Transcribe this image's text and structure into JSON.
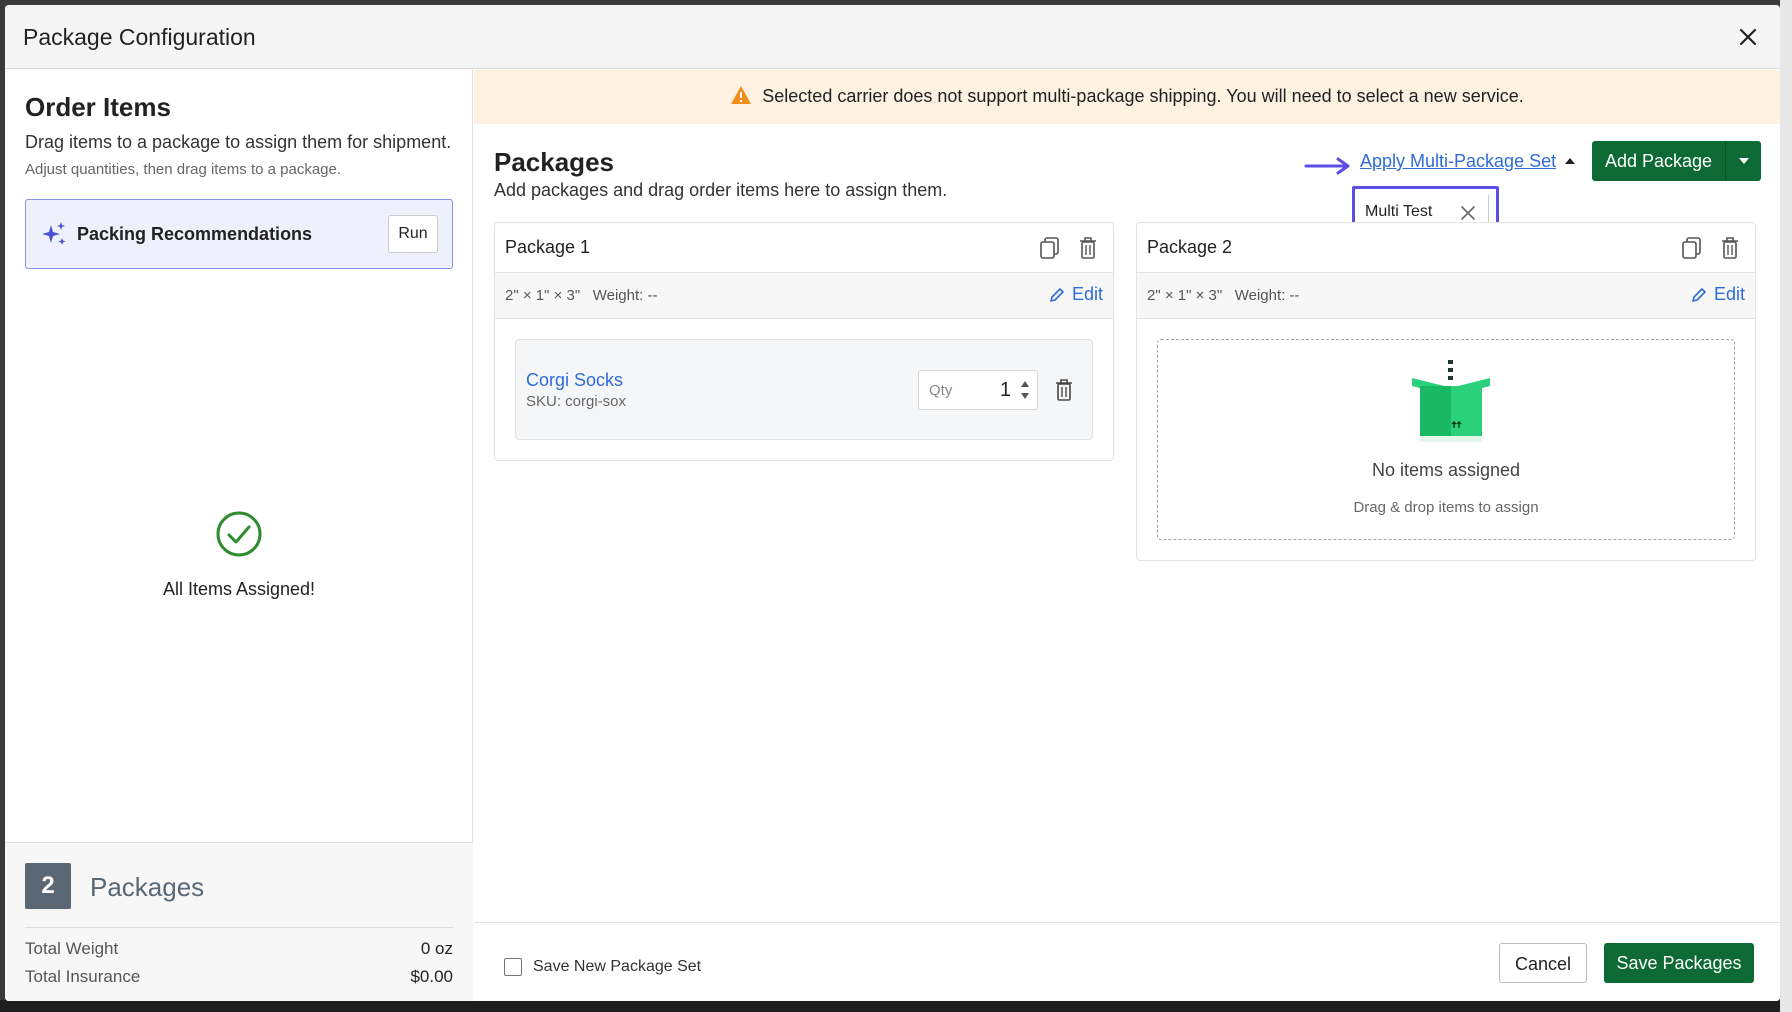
{
  "modal": {
    "title": "Package Configuration"
  },
  "order": {
    "title": "Order Items",
    "subtitle": "Drag items to a package to assign them for shipment.",
    "hint": "Adjust quantities, then drag items to a package.",
    "recommendations_label": "Packing Recommendations",
    "run_label": "Run",
    "assigned_text": "All Items Assigned!"
  },
  "summary": {
    "count": "2",
    "label": "Packages",
    "rows": [
      {
        "label": "Total Weight",
        "value": "0 oz"
      },
      {
        "label": "Total Insurance",
        "value": "$0.00"
      }
    ]
  },
  "warning": {
    "text": "Selected carrier does not support multi-package shipping. You will need to select a new service."
  },
  "packages_section": {
    "title": "Packages",
    "subtitle": "Add packages and drag order items here to assign them.",
    "apply_link": "Apply Multi-Package Set",
    "add_button": "Add Package",
    "popover_option": "Multi Test"
  },
  "packages": [
    {
      "name": "Package 1",
      "dims": "2\" × 1\" × 3\"",
      "weight": "Weight: --",
      "edit_label": "Edit",
      "item": {
        "name": "Corgi Socks",
        "sku": "SKU: corgi-sox",
        "qty_placeholder": "Qty",
        "qty": "1"
      }
    },
    {
      "name": "Package 2",
      "dims": "2\" × 1\" × 3\"",
      "weight": "Weight: --",
      "edit_label": "Edit",
      "empty_title": "No items assigned",
      "empty_sub": "Drag & drop items to assign"
    }
  ],
  "footer": {
    "save_set_label": "Save New Package Set",
    "cancel_label": "Cancel",
    "save_label": "Save Packages"
  },
  "colors": {
    "primary_green": "#0d6a34",
    "link_blue": "#2f6cd6",
    "highlight_purple": "#5b4de6",
    "warning_bg": "#fdf1e1",
    "warning_icon": "#f28c1b",
    "success_green": "#2e8b2e"
  }
}
